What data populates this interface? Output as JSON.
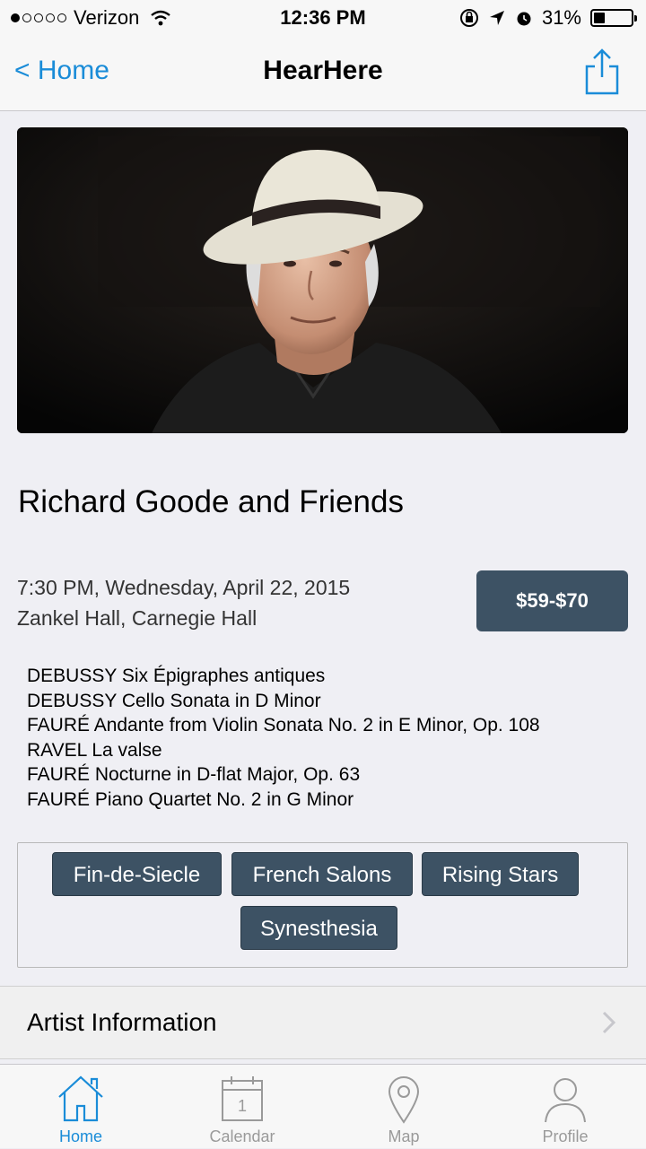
{
  "status_bar": {
    "carrier": "Verizon",
    "time": "12:36 PM",
    "battery": "31%",
    "battery_level": 0.31
  },
  "nav": {
    "back_label": "< Home",
    "title": "HearHere",
    "share_icon": "share-icon"
  },
  "event": {
    "title": "Richard Goode and Friends",
    "datetime": "7:30 PM, Wednesday, April 22, 2015",
    "venue": "Zankel Hall, Carnegie Hall",
    "price": "$59-$70"
  },
  "program": [
    "DEBUSSY Six Épigraphes antiques",
    "DEBUSSY Cello Sonata in D Minor",
    "FAURÉ Andante from Violin Sonata No. 2 in E Minor, Op. 108",
    "RAVEL La valse",
    "FAURÉ Nocturne in D-flat Major, Op. 63",
    "FAURÉ Piano Quartet No. 2 in G Minor"
  ],
  "tags": [
    "Fin-de-Siecle",
    "French Salons",
    "Rising Stars",
    "Synesthesia"
  ],
  "artist_info": {
    "label": "Artist Information"
  },
  "tabbar": {
    "items": [
      {
        "label": "Home",
        "icon": "home-icon",
        "active": true
      },
      {
        "label": "Calendar",
        "icon": "calendar-icon",
        "active": false,
        "day": "1"
      },
      {
        "label": "Map",
        "icon": "map-pin-icon",
        "active": false
      },
      {
        "label": "Profile",
        "icon": "profile-icon",
        "active": false
      }
    ]
  },
  "colors": {
    "accent": "#1a8cd8",
    "button": "#3d5264",
    "background": "#efeff4"
  }
}
